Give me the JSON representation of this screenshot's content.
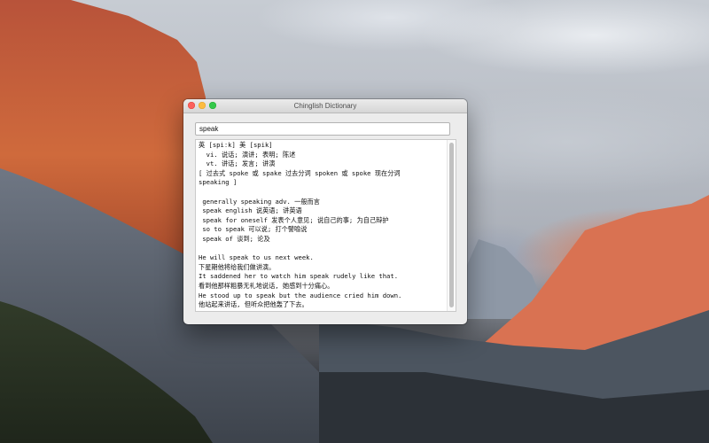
{
  "window": {
    "title": "Chinglish Dictionary"
  },
  "search": {
    "value": "speak"
  },
  "result": {
    "lines": [
      "英 [spiːk] 美 [spik]",
      "  vi. 说话; 演讲; 表明; 陈述",
      "  vt. 讲话; 发言; 讲演",
      "[ 过去式 spoke 或 spake 过去分词 spoken 或 spoke 现在分词",
      "speaking ]",
      "",
      " generally speaking adv. 一般而言",
      " speak english 说英语; 讲英语",
      " speak for oneself 发表个人意见; 说自己的事; 为自己辩护",
      " so to speak 可以说; 打个譬喻说",
      " speak of 谈到; 论及",
      "",
      "He will speak to us next week.",
      "下星期他将给我们做讲演。",
      "It saddened her to watch him speak rudely like that.",
      "看到他那样粗暴无礼地说话, 她感到十分痛心。",
      "He stood up to speak but the audience cried him down.",
      "他站起来讲话, 但听众把他轰了下去。"
    ]
  },
  "colors": {
    "close": "#fc615d",
    "minimize": "#fdbc40",
    "zoom": "#34c84a"
  },
  "icons": {
    "close": "close-button",
    "minimize": "minimize-button",
    "zoom": "zoom-button"
  }
}
